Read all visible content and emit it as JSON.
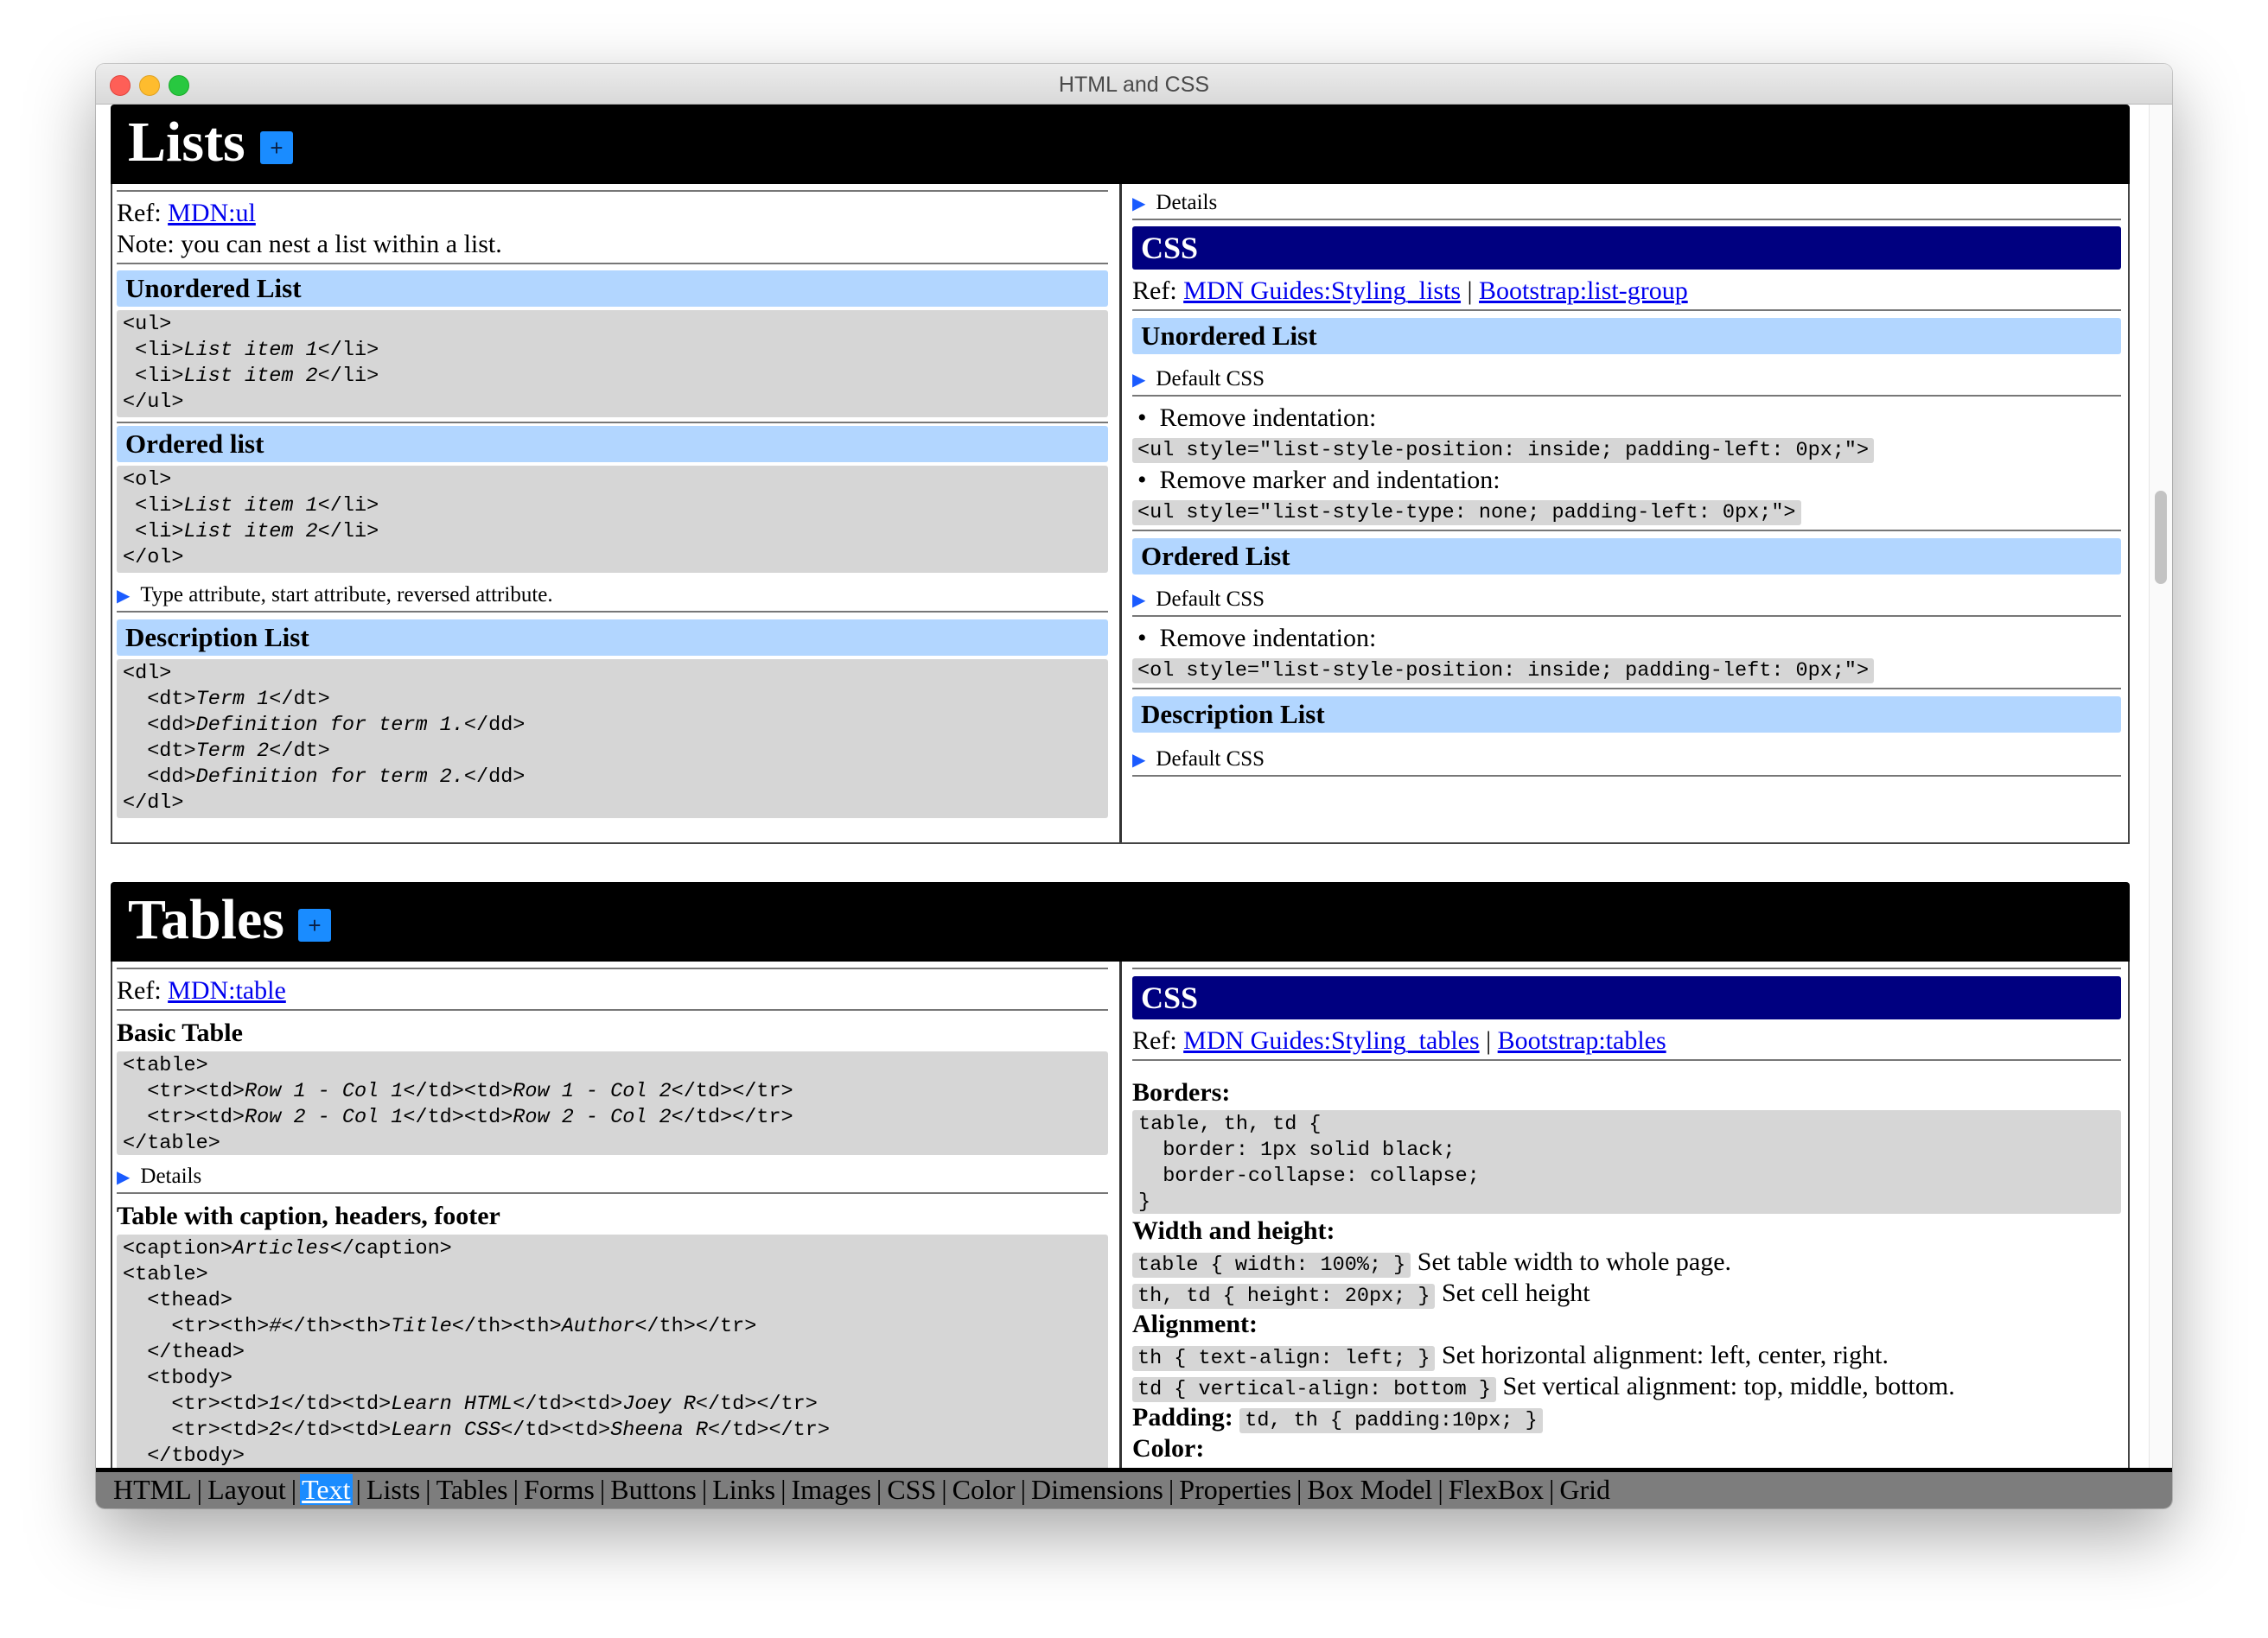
{
  "window": {
    "title": "HTML and CSS"
  },
  "lists": {
    "title": "Lists",
    "plus": "+",
    "left": {
      "ref_label": "Ref:",
      "ref_link": "MDN:ul",
      "note": "Note: you can nest a list within a list.",
      "unordered_title": "Unordered List",
      "ordered_title": "Ordered list",
      "type_attr_summary": "Type attribute, start attribute, reversed attribute.",
      "description_title": "Description List"
    },
    "right": {
      "details": "Details",
      "css_title": "CSS",
      "ref_label": "Ref:",
      "ref_link1": "MDN Guides:Styling_lists",
      "ref_sep": "|",
      "ref_link2": "Bootstrap:list-group",
      "unordered_title": "Unordered List",
      "default_css": "Default CSS",
      "remove_indent": "Remove indentation:",
      "ul_indent_code": "<ul style=\"list-style-position: inside; padding-left: 0px;\">",
      "remove_marker": "Remove marker and indentation:",
      "ul_marker_code": "<ul style=\"list-style-type: none; padding-left: 0px;\">",
      "ordered_title": "Ordered List",
      "ol_indent_code": "<ol style=\"list-style-position: inside; padding-left: 0px;\">",
      "description_title": "Description List"
    }
  },
  "tables": {
    "title": "Tables",
    "plus": "+",
    "left": {
      "ref_label": "Ref:",
      "ref_link": "MDN:table",
      "basic_title": "Basic Table",
      "details": "Details",
      "caption_title": "Table with caption, headers, footer"
    },
    "right": {
      "css_title": "CSS",
      "ref_label": "Ref:",
      "ref_link1": "MDN Guides:Styling_tables",
      "ref_sep": "|",
      "ref_link2": "Bootstrap:tables",
      "borders_title": "Borders:",
      "wh_title": "Width and height:",
      "width_code": "table { width: 100%; }",
      "width_text": "Set table width to whole page.",
      "height_code": "th, td { height: 20px; }",
      "height_text": "Set cell height",
      "align_title": "Alignment:",
      "halign_code": "th { text-align: left; }",
      "halign_text": "Set horizontal alignment: left, center, right.",
      "valign_code": "td { vertical-align: bottom }",
      "valign_text": "Set vertical alignment: top, middle, bottom.",
      "padding_title": "Padding:",
      "padding_code": "td, th { padding:10px; }",
      "color_title": "Color:"
    }
  },
  "nav": {
    "items": [
      "HTML",
      "Layout",
      "Text",
      "Lists",
      "Tables",
      "Forms",
      "Buttons",
      "Links",
      "Images",
      "CSS",
      "Color",
      "Dimensions",
      "Properties",
      "Box Model",
      "FlexBox",
      "Grid"
    ],
    "separator": "|",
    "active": "Text"
  }
}
